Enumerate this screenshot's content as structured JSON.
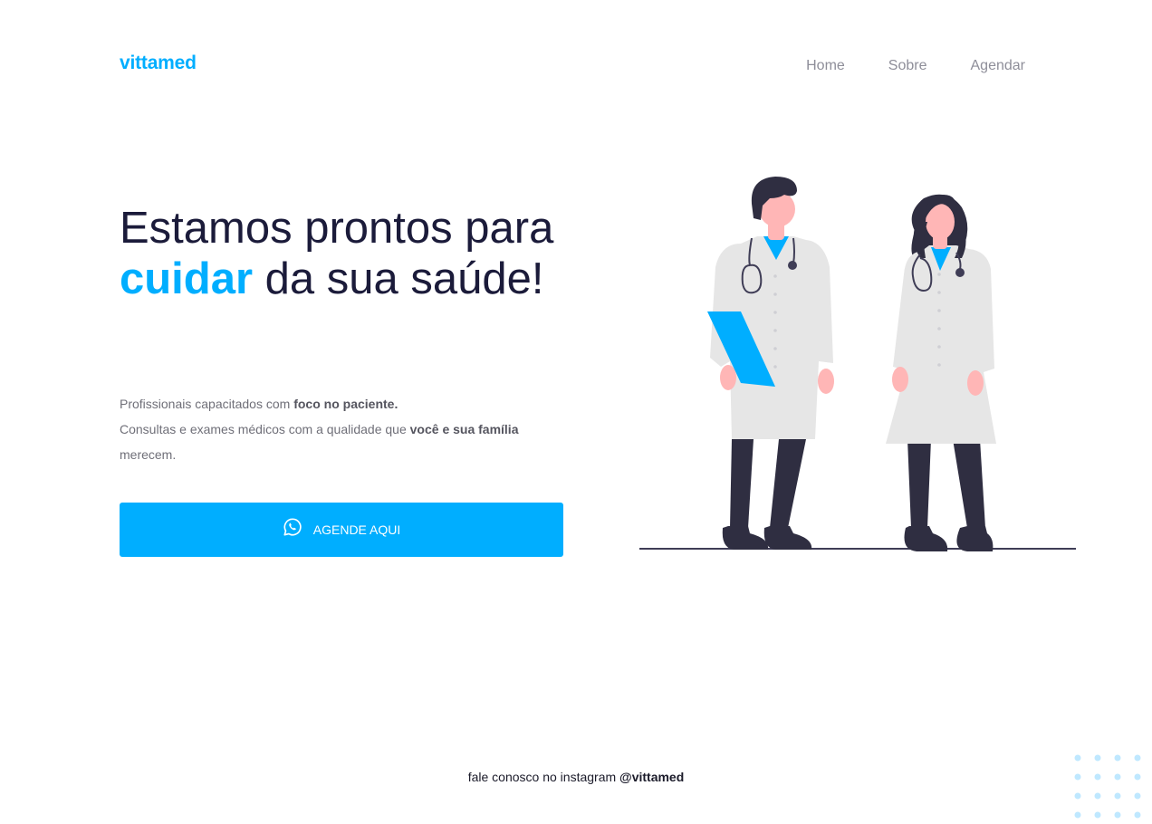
{
  "brand": {
    "name": "vittamed",
    "accent_color": "#00aeff"
  },
  "nav": {
    "items": [
      "Home",
      "Sobre",
      "Agendar"
    ]
  },
  "hero": {
    "title_part1": "Estamos prontos para ",
    "title_highlight": "cuidar",
    "title_part2": " da sua saúde!",
    "desc_line1_prefix": "Profissionais capacitados com ",
    "desc_line1_bold": "foco no paciente.",
    "desc_line2_prefix": "Consultas e exames médicos com a qualidade que ",
    "desc_line2_bold": "você e sua família",
    "desc_line2_suffix": " merecem.",
    "cta_label": "AGENDE AQUI",
    "cta_icon": "whatsapp-icon"
  },
  "footer": {
    "text": "fale conosco no instagram ",
    "handle": "@vittamed"
  }
}
